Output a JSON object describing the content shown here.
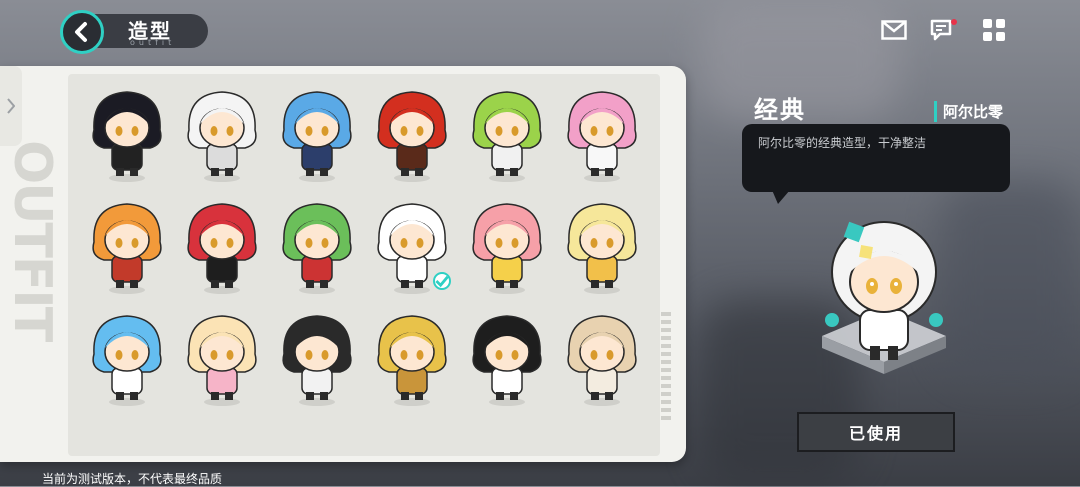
{
  "header": {
    "title": "造型",
    "subtitle": "outfit",
    "icons": [
      "back-arrow-icon",
      "mail-icon",
      "chat-icon",
      "grid-menu-icon"
    ],
    "accent": "#2fd0c4"
  },
  "panel": {
    "watermark": "OUTFIT",
    "grid": [
      {
        "hair": "#1b1b24",
        "face": "#fde7d2",
        "body": "#222"
      },
      {
        "hair": "#f4f4f4",
        "face": "#fde7d2",
        "body": "#dcdcdc"
      },
      {
        "hair": "#5aa9e6",
        "face": "#fde7d2",
        "body": "#2c3e6b"
      },
      {
        "hair": "#d32f1f",
        "face": "#fde7d2",
        "body": "#5a2a1a"
      },
      {
        "hair": "#9bd34a",
        "face": "#fde7d2",
        "body": "#f1f1f1"
      },
      {
        "hair": "#f2a0c8",
        "face": "#fde7d2",
        "body": "#f8f8f8"
      },
      {
        "hair": "#f29a3a",
        "face": "#fde7d2",
        "body": "#c23a2a"
      },
      {
        "hair": "#d8323c",
        "face": "#fde7d2",
        "body": "#1e1e1e"
      },
      {
        "hair": "#6bbf5a",
        "face": "#fde7d2",
        "body": "#c33"
      },
      {
        "hair": "#ffffff",
        "face": "#fde7d2",
        "body": "#ffffff",
        "selected": true
      },
      {
        "hair": "#f6a0a8",
        "face": "#fde7d2",
        "body": "#f5d04a"
      },
      {
        "hair": "#f6e79a",
        "face": "#fde7d2",
        "body": "#f2c04a"
      },
      {
        "hair": "#64bdf0",
        "face": "#fde7d2",
        "body": "#ffffff"
      },
      {
        "hair": "#fbe3b5",
        "face": "#fde7d2",
        "body": "#f6b4c8"
      },
      {
        "hair": "#2a2a2a",
        "face": "#fde7d2",
        "body": "#f2f2f2"
      },
      {
        "hair": "#e8c24a",
        "face": "#fde7d2",
        "body": "#c9953a"
      },
      {
        "hair": "#1e1e1e",
        "face": "#fde7d2",
        "body": "#ffffff"
      },
      {
        "hair": "#e8d2b0",
        "face": "#fde7d2",
        "body": "#f3ece0"
      }
    ]
  },
  "detail": {
    "outfit_name": "经典",
    "character_name": "阿尔比零",
    "description": "阿尔比零的经典造型，干净整洁",
    "use_button": "已使用"
  },
  "footer": "当前为测试版本，不代表最终品质"
}
